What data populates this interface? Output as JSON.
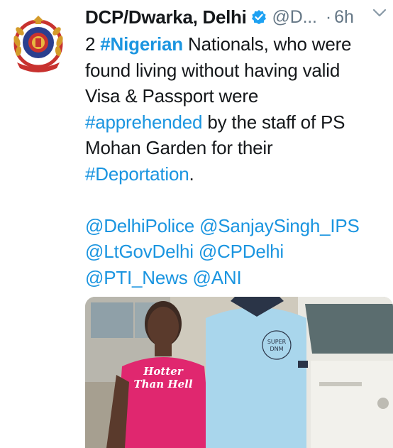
{
  "tweet": {
    "display_name": "DCP/Dwarka, Delhi",
    "handle": "@D...",
    "separator": "·",
    "time": "6h",
    "avatar_icon": "delhi-police-emblem-icon",
    "verified_icon": "verified-badge-icon",
    "menu_icon": "chevron-down-icon",
    "text": {
      "line1_prefix": "2 ",
      "hashtag_nigerian": "#Nigerian",
      "line1_suffix": " Nationals, who were",
      "line2": "found living without having valid",
      "line3": "Visa & Passport were",
      "hashtag_apprehended": "#apprehended",
      "line4_suffix": " by the staff of PS",
      "line5": "Mohan Garden for their",
      "hashtag_deportation": "#Deportation",
      "line6_suffix": ".",
      "mention_delhipolice": "@DelhiPolice",
      "mention_sanjay": "@SanjaySingh_IPS",
      "mention_ltgov": "@LtGovDelhi",
      "mention_cpdelhi": "@CPDelhi",
      "mention_pti": "@PTI_News",
      "mention_ani": "@ANI"
    },
    "media": {
      "shirt1_line1": "Hotter",
      "shirt1_line2": "Than Hell",
      "shirt2_line1": "SUPER",
      "shirt2_line2": "DNM"
    }
  },
  "colors": {
    "link": "#1b95e0",
    "secondary": "#657786",
    "text": "#14171a",
    "verified": "#1da1f2"
  }
}
